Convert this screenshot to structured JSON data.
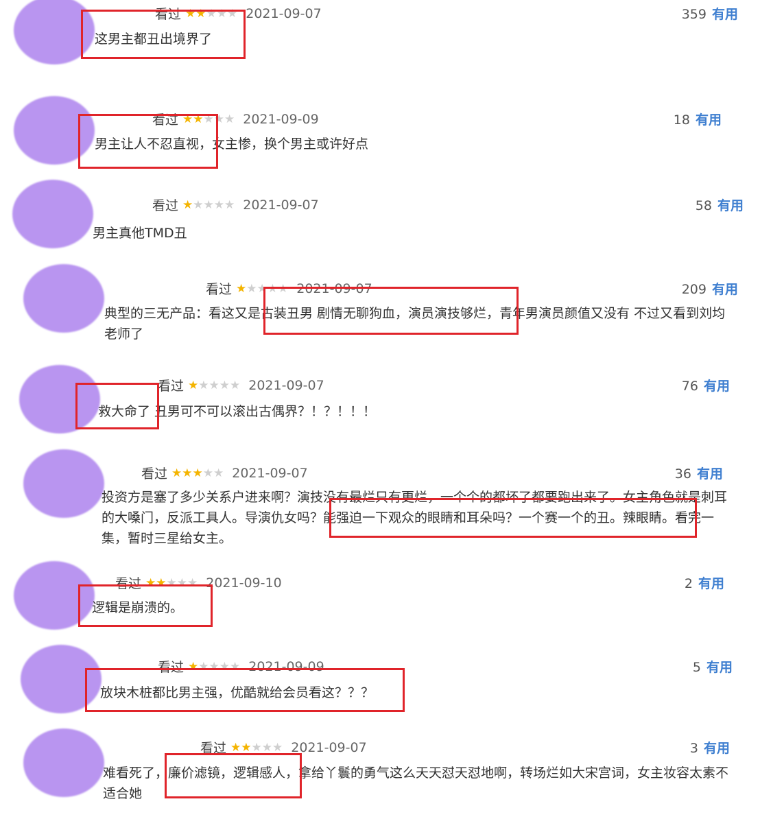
{
  "ui": {
    "accent_useful": "#3f7fd0",
    "star_color": "#f4b400",
    "highlight_color": "#e0242a",
    "avatar_color": "#b995f0"
  },
  "icons": {
    "avatar": "user-avatar-icon",
    "star": "star-icon"
  },
  "reviews": [
    {
      "watched": "看过",
      "stars": 2,
      "date": "2021-09-07",
      "count": "359",
      "useful": "有用",
      "text": "这男主都丑出境界了"
    },
    {
      "watched": "看过",
      "stars": 2,
      "date": "2021-09-09",
      "count": "18",
      "useful": "有用",
      "text": "男主让人不忍直视，女主惨，换个男主或许好点"
    },
    {
      "watched": "看过",
      "stars": 1,
      "date": "2021-09-07",
      "count": "58",
      "useful": "有用",
      "text": "男主真他TMD丑"
    },
    {
      "watched": "看过",
      "stars": 1,
      "date": "2021-09-07",
      "count": "209",
      "useful": "有用",
      "text": "典型的三无产品：看这又是古装丑男 剧情无聊狗血，演员演技够烂，青年男演员颜值又没有 不过又看到刘均老师了"
    },
    {
      "watched": "看过",
      "stars": 1,
      "date": "2021-09-07",
      "count": "76",
      "useful": "有用",
      "text": "救大命了 丑男可不可以滚出古偶界？！？！！！"
    },
    {
      "watched": "看过",
      "stars": 3,
      "date": "2021-09-07",
      "count": "36",
      "useful": "有用",
      "text": "投资方是塞了多少关系户进来啊？演技没有最烂只有更烂，一个个的都坏了都要跑出来了。女主角色就是刺耳的大嗓门，反派工具人。导演仇女吗？能强迫一下观众的眼睛和耳朵吗？一个赛一个的丑。辣眼睛。看完一集，暂时三星给女主。"
    },
    {
      "watched": "看过",
      "stars": 2,
      "date": "2021-09-10",
      "count": "2",
      "useful": "有用",
      "text": "逻辑是崩溃的。"
    },
    {
      "watched": "看过",
      "stars": 1,
      "date": "2021-09-09",
      "count": "5",
      "useful": "有用",
      "text": "放块木桩都比男主强，优酷就给会员看这？？？"
    },
    {
      "watched": "看过",
      "stars": 2,
      "date": "2021-09-07",
      "count": "3",
      "useful": "有用",
      "text": "难看死了，廉价滤镜，逻辑感人，拿给丫鬟的勇气这么天天怼天怼地啊，转场烂如大宋宫词，女主妆容太素不适合她"
    }
  ]
}
